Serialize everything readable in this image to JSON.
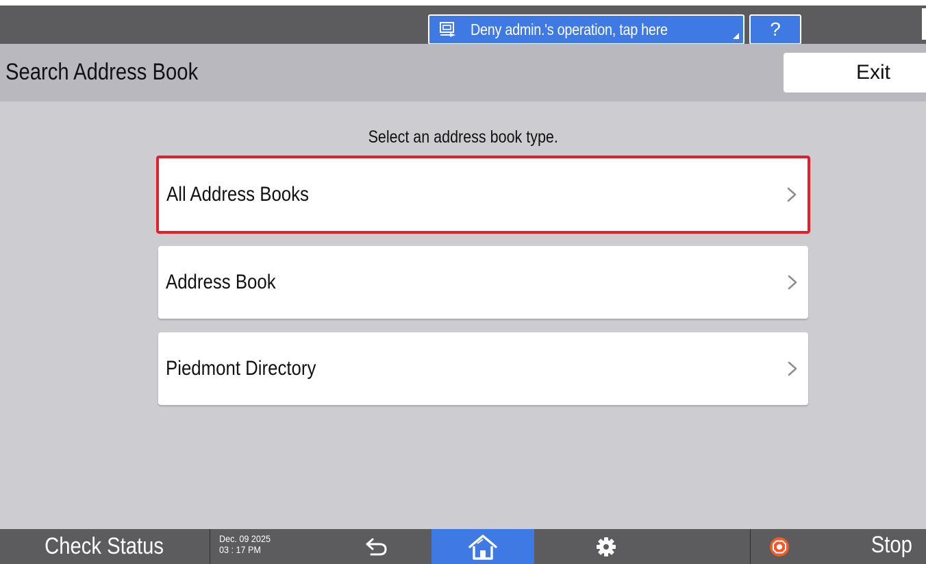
{
  "status_bar": {
    "remote_button_label": "Deny admin.'s operation, tap here",
    "remote_icon": "remote-screen-icon",
    "help_label": "?"
  },
  "header": {
    "title": "Search Address Book",
    "exit_label": "Exit"
  },
  "main": {
    "instruction": "Select an address book type.",
    "items": [
      {
        "label": "All Address Books",
        "selected": true
      },
      {
        "label": "Address Book",
        "selected": false
      },
      {
        "label": "Piedmont Directory",
        "selected": false
      }
    ],
    "chevron_icon": "chevron-right-icon"
  },
  "footer": {
    "check_status_label": "Check Status",
    "date": "Dec. 09 2025",
    "time": "03 : 17 PM",
    "back_icon": "back-arrow-icon",
    "home_icon": "home-icon",
    "settings_icon": "gear-icon",
    "stop_icon": "stop-icon",
    "stop_label": "Stop"
  },
  "colors": {
    "bar_gray": "#5c5c5e",
    "accent_blue": "#3f79e4",
    "header_gray": "#b9b8be",
    "panel_gray": "#cdccd1",
    "highlight_red": "#e61e2b",
    "stop_orange": "#f05a28"
  }
}
